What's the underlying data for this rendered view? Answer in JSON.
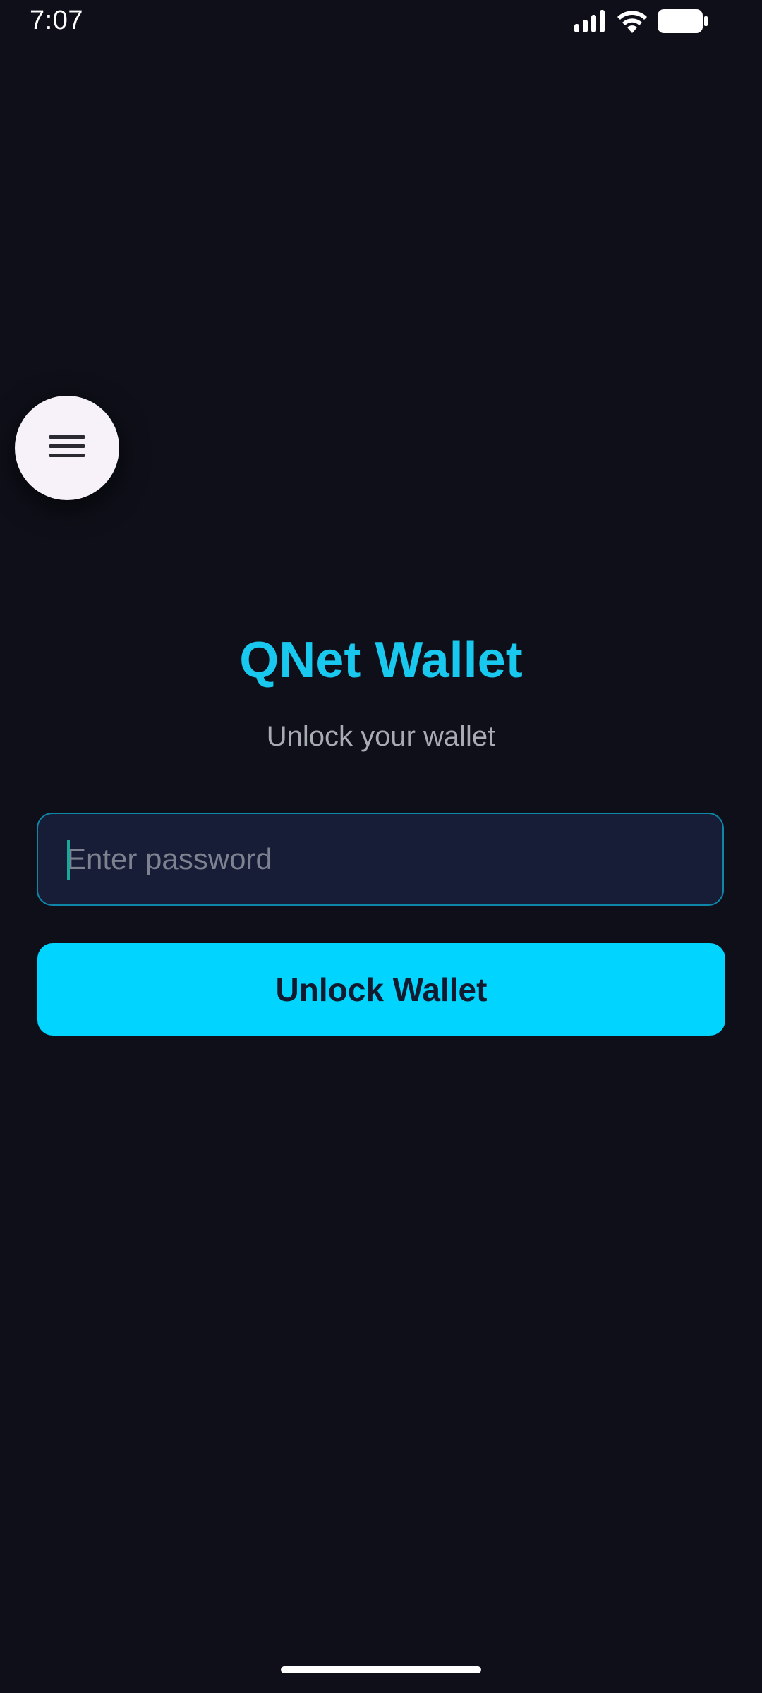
{
  "status_bar": {
    "time": "7:07",
    "icons": [
      "signal-icon",
      "wifi-icon",
      "battery-icon"
    ]
  },
  "menu": {
    "icon": "hamburger-menu-icon"
  },
  "main": {
    "title": "QNet Wallet",
    "subtitle": "Unlock your wallet",
    "password_placeholder": "Enter password",
    "password_value": "",
    "unlock_label": "Unlock Wallet"
  },
  "colors": {
    "background": "#0e0f18",
    "accent": "#00d4ff",
    "title": "#18c8ee",
    "field_bg": "#171d36",
    "field_border": "#0e86a8"
  }
}
